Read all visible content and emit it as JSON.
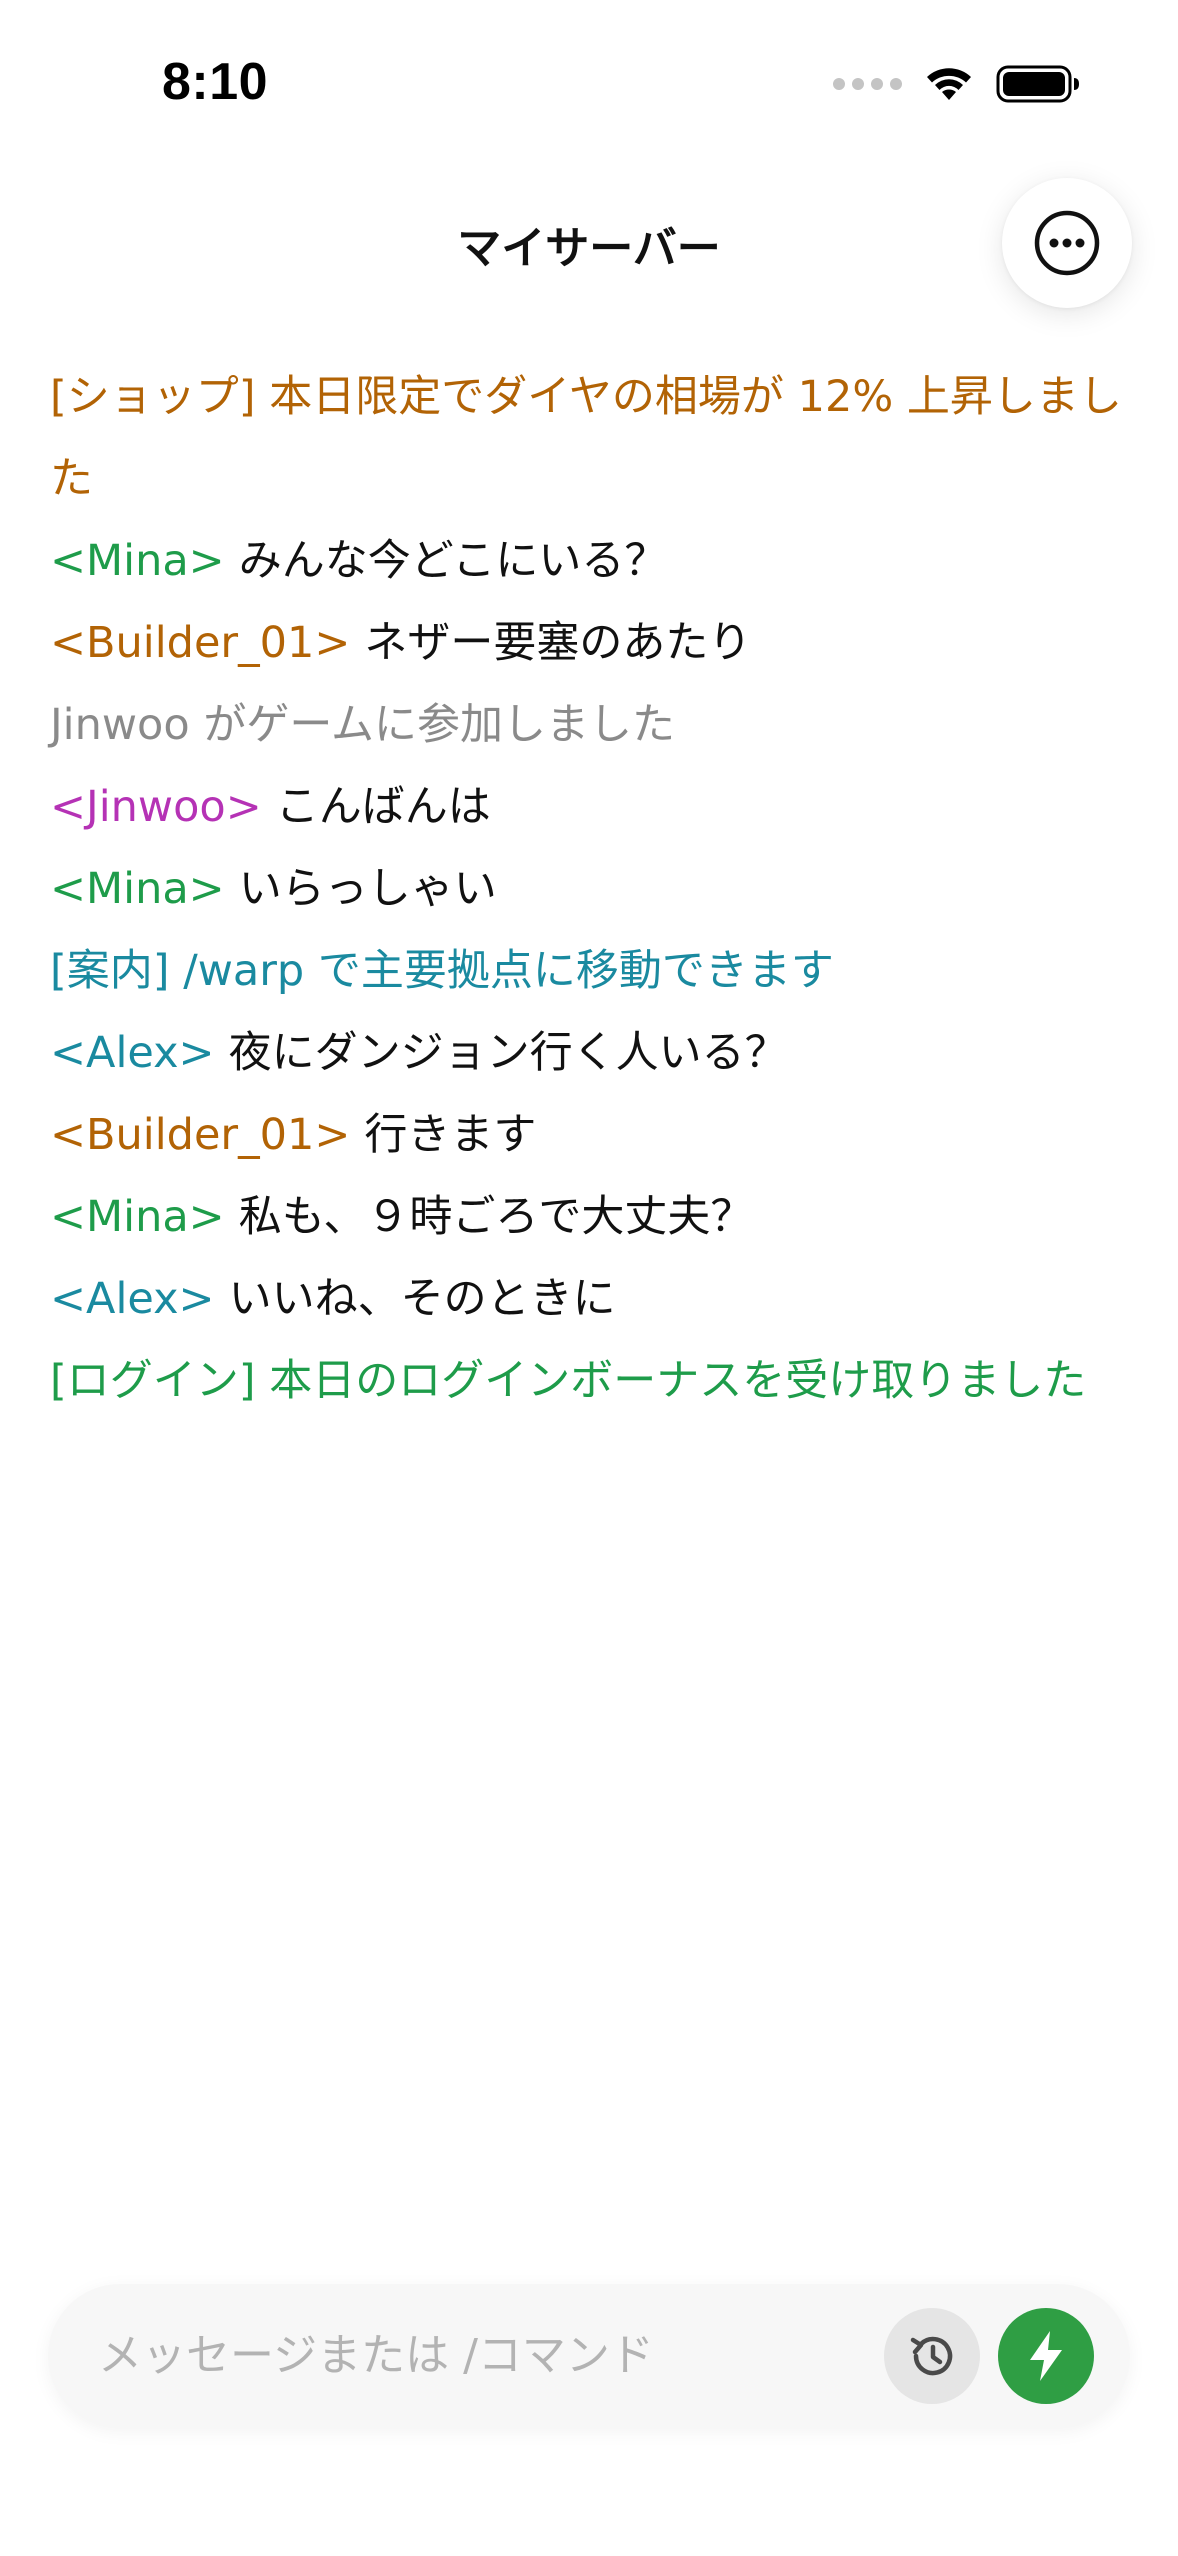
{
  "status_bar": {
    "time": "8:10",
    "icons": [
      "signal-icon",
      "wifi-icon",
      "battery-icon"
    ]
  },
  "header": {
    "title": "マイサーバー",
    "more_icon": "more-horizontal-icon"
  },
  "colors": {
    "shop": "#b26305",
    "green": "#1e9c4a",
    "teal": "#1a8aa0",
    "orange": "#b26305",
    "magenta": "#b532b5",
    "system_gray": "#8a8a8a",
    "text": "#111111",
    "send_button": "#2f9e44",
    "history_button": "#e5e5e5"
  },
  "chat": {
    "messages": [
      {
        "type": "notice",
        "text": "[ショップ] 本日限定でダイヤの相場が 12% 上昇しました",
        "color": "#b26305"
      },
      {
        "type": "player",
        "name": "<Mina>",
        "text": "みんな今どこにいる？",
        "name_color": "#1e9c4a"
      },
      {
        "type": "player",
        "name": "<Builder_01>",
        "text": "ネザー要塞のあたり",
        "name_color": "#b26305"
      },
      {
        "type": "system",
        "text": "Jinwoo がゲームに参加しました",
        "color": "#8a8a8a"
      },
      {
        "type": "player",
        "name": "<Jinwoo>",
        "text": "こんばんは",
        "name_color": "#b532b5"
      },
      {
        "type": "player",
        "name": "<Mina>",
        "text": "いらっしゃい",
        "name_color": "#1e9c4a"
      },
      {
        "type": "notice",
        "text": "[案内] /warp で主要拠点に移動できます",
        "color": "#1a8aa0"
      },
      {
        "type": "player",
        "name": "<Alex>",
        "text": "夜にダンジョン行く人いる？",
        "name_color": "#1a8aa0"
      },
      {
        "type": "player",
        "name": "<Builder_01>",
        "text": "行きます",
        "name_color": "#b26305"
      },
      {
        "type": "player",
        "name": "<Mina>",
        "text": "私も、９時ごろで大丈夫？",
        "name_color": "#1e9c4a"
      },
      {
        "type": "player",
        "name": "<Alex>",
        "text": "いいね、そのときに",
        "name_color": "#1a8aa0"
      },
      {
        "type": "notice",
        "text": "[ログイン] 本日のログインボーナスを受け取りました",
        "color": "#1e9c4a"
      }
    ]
  },
  "input": {
    "placeholder": "メッセージまたは /コマンド",
    "value": "",
    "history_icon": "history-icon",
    "send_icon": "lightning-bolt-icon"
  }
}
